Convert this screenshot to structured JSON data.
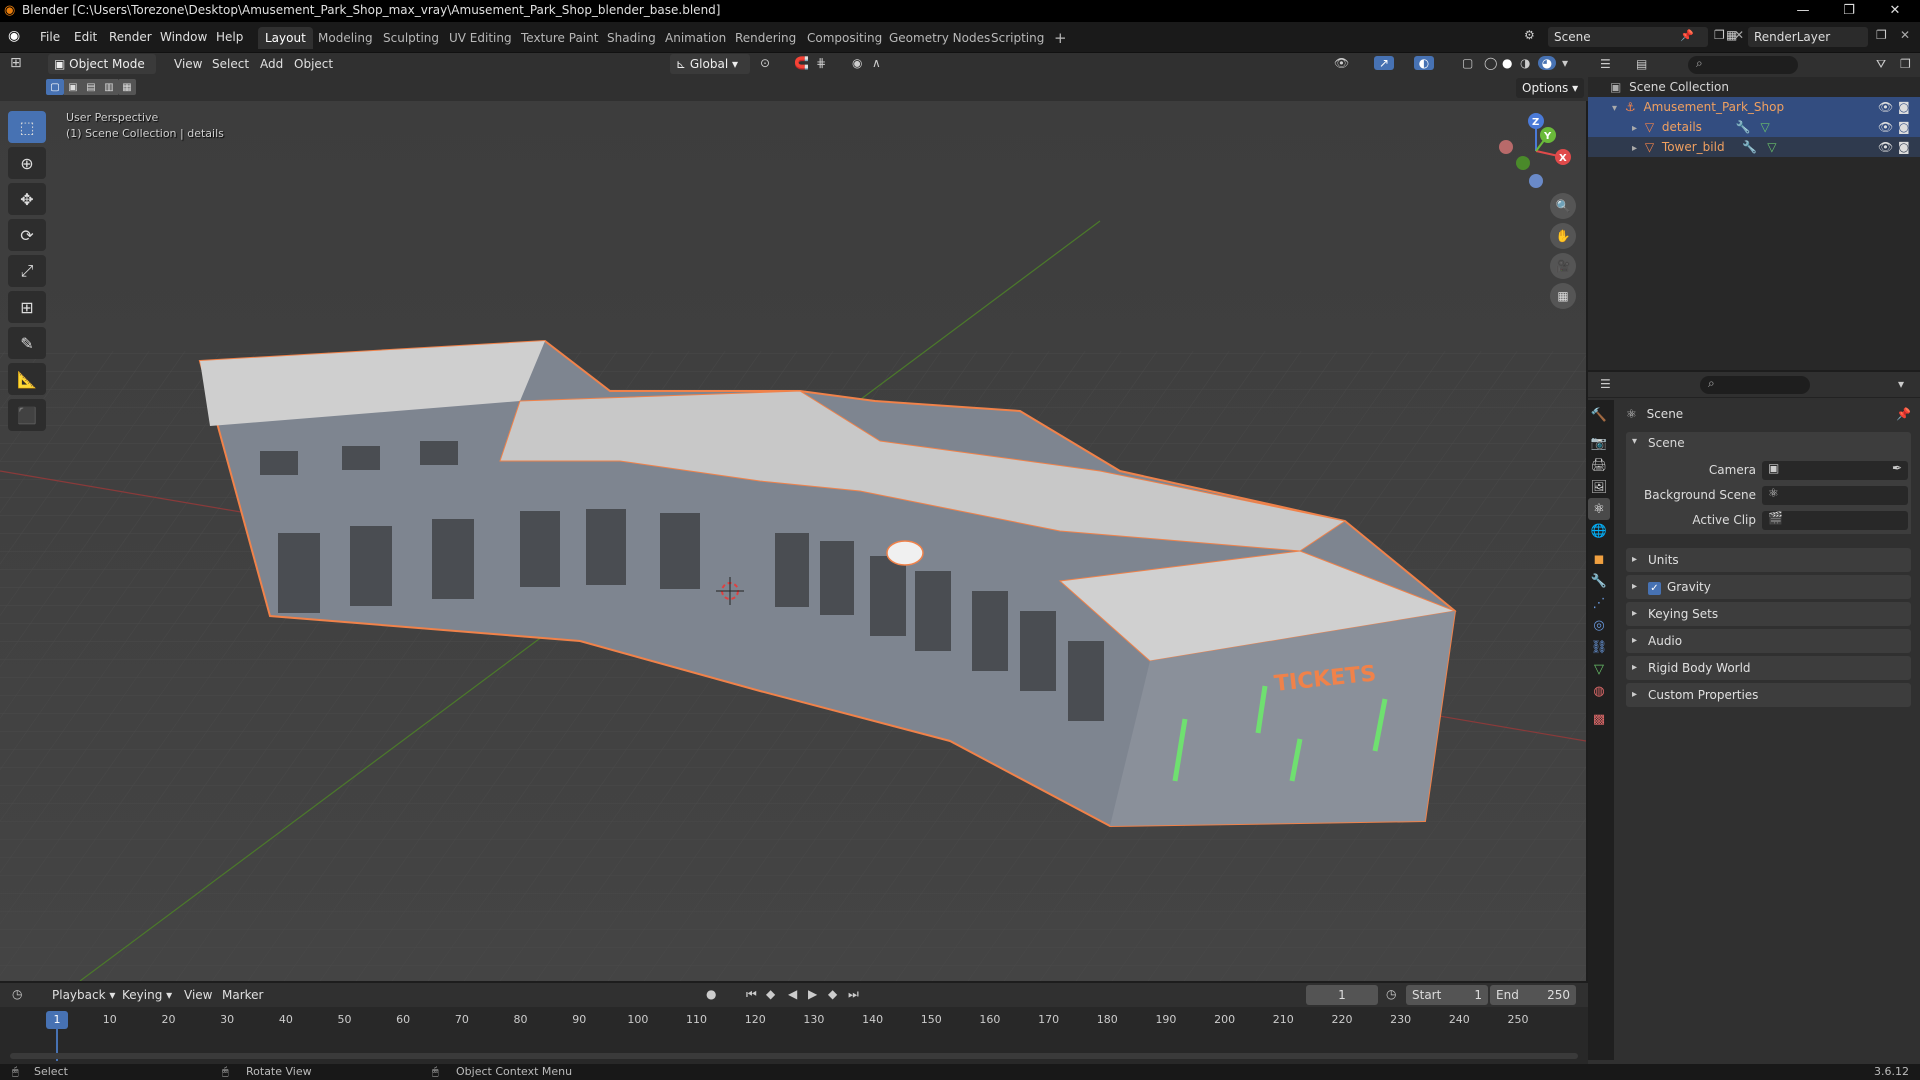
{
  "window": {
    "title": "Blender [C:\\Users\\Torezone\\Desktop\\Amusement_Park_Shop_max_vray\\Amusement_Park_Shop_blender_base.blend]"
  },
  "menus": [
    "File",
    "Edit",
    "Render",
    "Window",
    "Help"
  ],
  "workspaces": [
    "Layout",
    "Modeling",
    "Sculpting",
    "UV Editing",
    "Texture Paint",
    "Shading",
    "Animation",
    "Rendering",
    "Compositing",
    "Geometry Nodes",
    "Scripting"
  ],
  "scene_field": "Scene",
  "render_layer": "RenderLayer",
  "viewport": {
    "mode": "Object Mode",
    "menus": [
      "View",
      "Select",
      "Add",
      "Object"
    ],
    "orientation": "Global",
    "options": "Options",
    "perspective_label": "User Perspective",
    "collection_label": "(1) Scene Collection | details",
    "sign_text": "TICKETS",
    "axis": {
      "x": "X",
      "y": "Y",
      "z": "Z"
    }
  },
  "outliner": {
    "root": "Scene Collection",
    "items": [
      {
        "label": "Amusement_Park_Shop"
      },
      {
        "label": "details"
      },
      {
        "label": "Tower_bild"
      }
    ]
  },
  "properties": {
    "header": "Scene",
    "section": "Scene",
    "fields": [
      {
        "label": "Camera",
        "value": ""
      },
      {
        "label": "Background Scene",
        "value": ""
      },
      {
        "label": "Active Clip",
        "value": ""
      }
    ],
    "panels": [
      "Units",
      "Gravity",
      "Keying Sets",
      "Audio",
      "Rigid Body World",
      "Custom Properties"
    ],
    "gravity_checked": true
  },
  "timeline": {
    "menus": [
      "Playback",
      "Keying",
      "View",
      "Marker"
    ],
    "current_frame": "1",
    "start_label": "Start",
    "start": "1",
    "end_label": "End",
    "end": "250",
    "ticks": [
      "1",
      "10",
      "20",
      "30",
      "40",
      "50",
      "60",
      "70",
      "80",
      "90",
      "100",
      "110",
      "120",
      "130",
      "140",
      "150",
      "160",
      "170",
      "180",
      "190",
      "200",
      "210",
      "220",
      "230",
      "240",
      "250"
    ]
  },
  "statusbar": {
    "items": [
      "Select",
      "Rotate View",
      "Object Context Menu"
    ],
    "version": "3.6.12"
  },
  "colors": {
    "selected": "#334d80",
    "accent": "#4772b3",
    "highlight_orange": "#f0824a"
  }
}
